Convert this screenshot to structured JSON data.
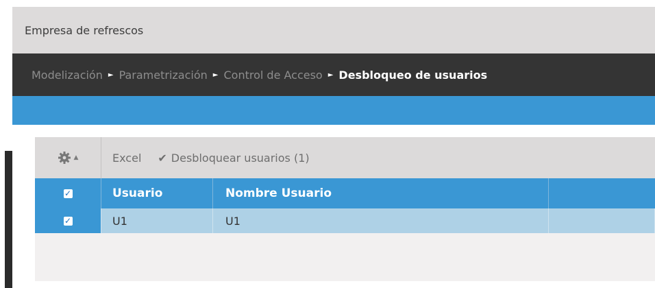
{
  "header": {
    "company": "Empresa de refrescos"
  },
  "breadcrumb": {
    "items": [
      "Modelización",
      "Parametrización",
      "Control de Acceso",
      "Desbloqueo de usuarios"
    ],
    "separator": "►"
  },
  "toolbar": {
    "settings_icon": "gear-icon",
    "caret": "▲",
    "excel_label": "Excel",
    "unlock_icon": "check-icon",
    "unlock_label": "Desbloquear usuarios (1)"
  },
  "grid": {
    "columns": [
      "Usuario",
      "Nombre Usuario"
    ],
    "header_checked": true,
    "rows": [
      {
        "selected": true,
        "usuario": "U1",
        "nombre": "U1"
      }
    ]
  },
  "colors": {
    "accent": "#3a97d4",
    "breadcrumb_bg": "#343434",
    "company_bg": "#dddbdb",
    "selected_row": "#aed1e6"
  }
}
